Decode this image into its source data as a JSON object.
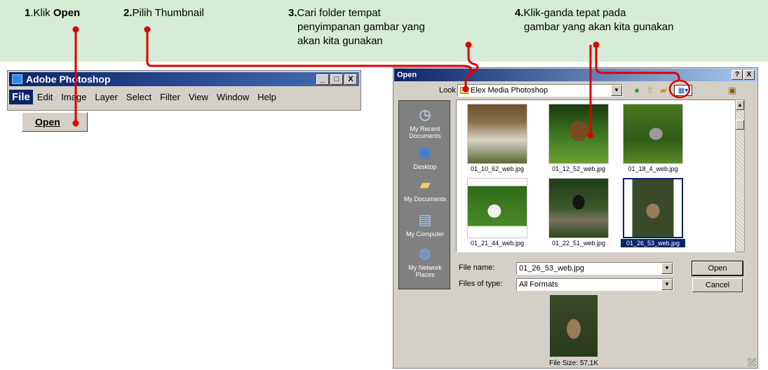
{
  "instructions": {
    "step1": {
      "num": "1",
      "text": ".Klik ",
      "bold": "Open"
    },
    "step2": {
      "num": "2.",
      "text": "Pilih Thumbnail"
    },
    "step3": {
      "num": "3.",
      "line1": "Cari folder tempat",
      "line2": "penyimpanan gambar yang",
      "line3": "akan kita gunakan"
    },
    "step4": {
      "num": "4.",
      "line1": "Klik-ganda tepat pada",
      "line2": "gambar yang akan kita gunakan"
    }
  },
  "colors": {
    "banner": "#d6ecd6",
    "callout": "#dd0000",
    "titlebar": "#0a246a"
  },
  "photoshop": {
    "title": "Adobe Photoshop",
    "controls": [
      "_",
      "□",
      "X"
    ],
    "menu": [
      "File",
      "Edit",
      "Image",
      "Layer",
      "Select",
      "Filter",
      "View",
      "Window",
      "Help"
    ],
    "open_item": "Open"
  },
  "dialog": {
    "title": "Open",
    "controls": [
      "?",
      "X"
    ],
    "lookin_label": "Look in:",
    "lookin_value": "Elex Media Photoshop",
    "places": [
      {
        "label": "My Recent Documents",
        "icon": "recent-icon"
      },
      {
        "label": "Desktop",
        "icon": "desktop-icon"
      },
      {
        "label": "My Documents",
        "icon": "documents-icon"
      },
      {
        "label": "My Computer",
        "icon": "computer-icon"
      },
      {
        "label": "My Network Places",
        "icon": "network-icon"
      }
    ],
    "files": [
      {
        "name": "01_10_62_web.jpg"
      },
      {
        "name": "01_12_52_web.jpg"
      },
      {
        "name": "01_18_4_web.jpg"
      },
      {
        "name": "01_21_44_web.jpg"
      },
      {
        "name": "01_22_51_web.jpg"
      },
      {
        "name": "01_26_53_web.jpg",
        "selected": true
      }
    ],
    "file_name_label": "File name:",
    "file_name_value": "01_26_53_web.jpg",
    "files_of_type_label": "Files of type:",
    "files_of_type_value": "All Formats",
    "open_button": "Open",
    "cancel_button": "Cancel",
    "file_size": "File Size: 57,1K"
  }
}
